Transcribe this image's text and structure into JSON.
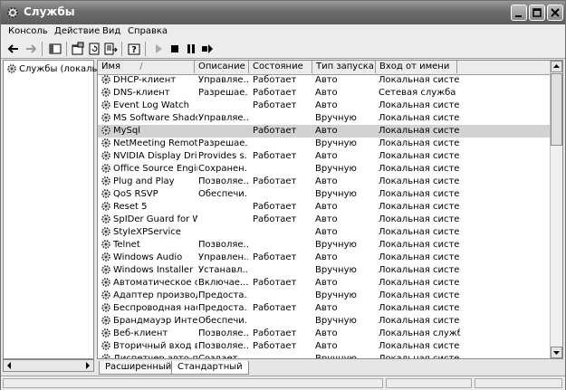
{
  "window": {
    "title": "Службы"
  },
  "menu": [
    "Консоль",
    "Действие",
    "Вид",
    "Справка"
  ],
  "tree": {
    "root_label": "Службы (локальны"
  },
  "columns": {
    "name": "Имя",
    "sort_indicator": "/",
    "description": "Описание",
    "status": "Состояние",
    "startup": "Тип запуска",
    "logon": "Вход от имени"
  },
  "services": [
    {
      "name": "DHCP-клиент",
      "description": "Управляе...",
      "status": "Работает",
      "startup": "Авто",
      "logon": "Локальная система"
    },
    {
      "name": "DNS-клиент",
      "description": "Разрешае...",
      "status": "Работает",
      "startup": "Авто",
      "logon": "Сетевая служба"
    },
    {
      "name": "Event Log Watch",
      "description": "",
      "status": "Работает",
      "startup": "Авто",
      "logon": "Локальная система"
    },
    {
      "name": "MS Software Shado...",
      "description": "Управляе...",
      "status": "",
      "startup": "Вручную",
      "logon": "Локальная система"
    },
    {
      "name": "MySql",
      "description": "",
      "status": "Работает",
      "startup": "Авто",
      "logon": "Локальная система",
      "selected": true
    },
    {
      "name": "NetMeeting Remote...",
      "description": "Разрешае...",
      "status": "",
      "startup": "Вручную",
      "logon": "Локальная система"
    },
    {
      "name": "NVIDIA Display Driv...",
      "description": "Provides s...",
      "status": "Работает",
      "startup": "Авто",
      "logon": "Локальная система"
    },
    {
      "name": "Office Source Engine",
      "description": "Сохранен...",
      "status": "",
      "startup": "Вручную",
      "logon": "Локальная система"
    },
    {
      "name": "Plug and Play",
      "description": "Позволяе...",
      "status": "Работает",
      "startup": "Авто",
      "logon": "Локальная система"
    },
    {
      "name": "QoS RSVP",
      "description": "Обеспечи...",
      "status": "",
      "startup": "Вручную",
      "logon": "Локальная система"
    },
    {
      "name": "Reset 5",
      "description": "",
      "status": "Работает",
      "startup": "Авто",
      "logon": "Локальная система"
    },
    {
      "name": "SpIDer Guard for W...",
      "description": "",
      "status": "Работает",
      "startup": "Авто",
      "logon": "Локальная система"
    },
    {
      "name": "StyleXPService",
      "description": "",
      "status": "",
      "startup": "Авто",
      "logon": "Локальная система"
    },
    {
      "name": "Telnet",
      "description": "Позволяе...",
      "status": "",
      "startup": "Вручную",
      "logon": "Локальная система"
    },
    {
      "name": "Windows Audio",
      "description": "Управлен...",
      "status": "Работает",
      "startup": "Авто",
      "logon": "Локальная система"
    },
    {
      "name": "Windows Installer",
      "description": "Устанавл...",
      "status": "",
      "startup": "Вручную",
      "logon": "Локальная система"
    },
    {
      "name": "Автоматическое о...",
      "description": "Включае...",
      "status": "Работает",
      "startup": "Авто",
      "logon": "Локальная система"
    },
    {
      "name": "Адаптер производ...",
      "description": "Предоста...",
      "status": "",
      "startup": "Вручную",
      "logon": "Локальная система"
    },
    {
      "name": "Беспроводная нас...",
      "description": "Предоста...",
      "status": "Работает",
      "startup": "Авто",
      "logon": "Локальная система"
    },
    {
      "name": "Брандмауэр Интер...",
      "description": "Обеспечи...",
      "status": "",
      "startup": "Вручную",
      "logon": "Локальная система"
    },
    {
      "name": "Веб-клиент",
      "description": "Позволяе...",
      "status": "Работает",
      "startup": "Авто",
      "logon": "Локальная служба"
    },
    {
      "name": "Вторичный вход в ...",
      "description": "Позволяе...",
      "status": "Работает",
      "startup": "Авто",
      "logon": "Локальная система"
    },
    {
      "name": "Диспетчер авто-п...",
      "description": "Создает ...",
      "status": "",
      "startup": "Вручную",
      "logon": "Локальная система"
    }
  ],
  "tabs": [
    "Расширенный",
    "Стандартный"
  ],
  "icons": {
    "service": "gear-icon",
    "back": "back-arrow-icon",
    "forward": "forward-arrow-icon",
    "play": "play-icon",
    "stop": "stop-icon",
    "pause": "pause-icon",
    "restart": "restart-icon"
  }
}
